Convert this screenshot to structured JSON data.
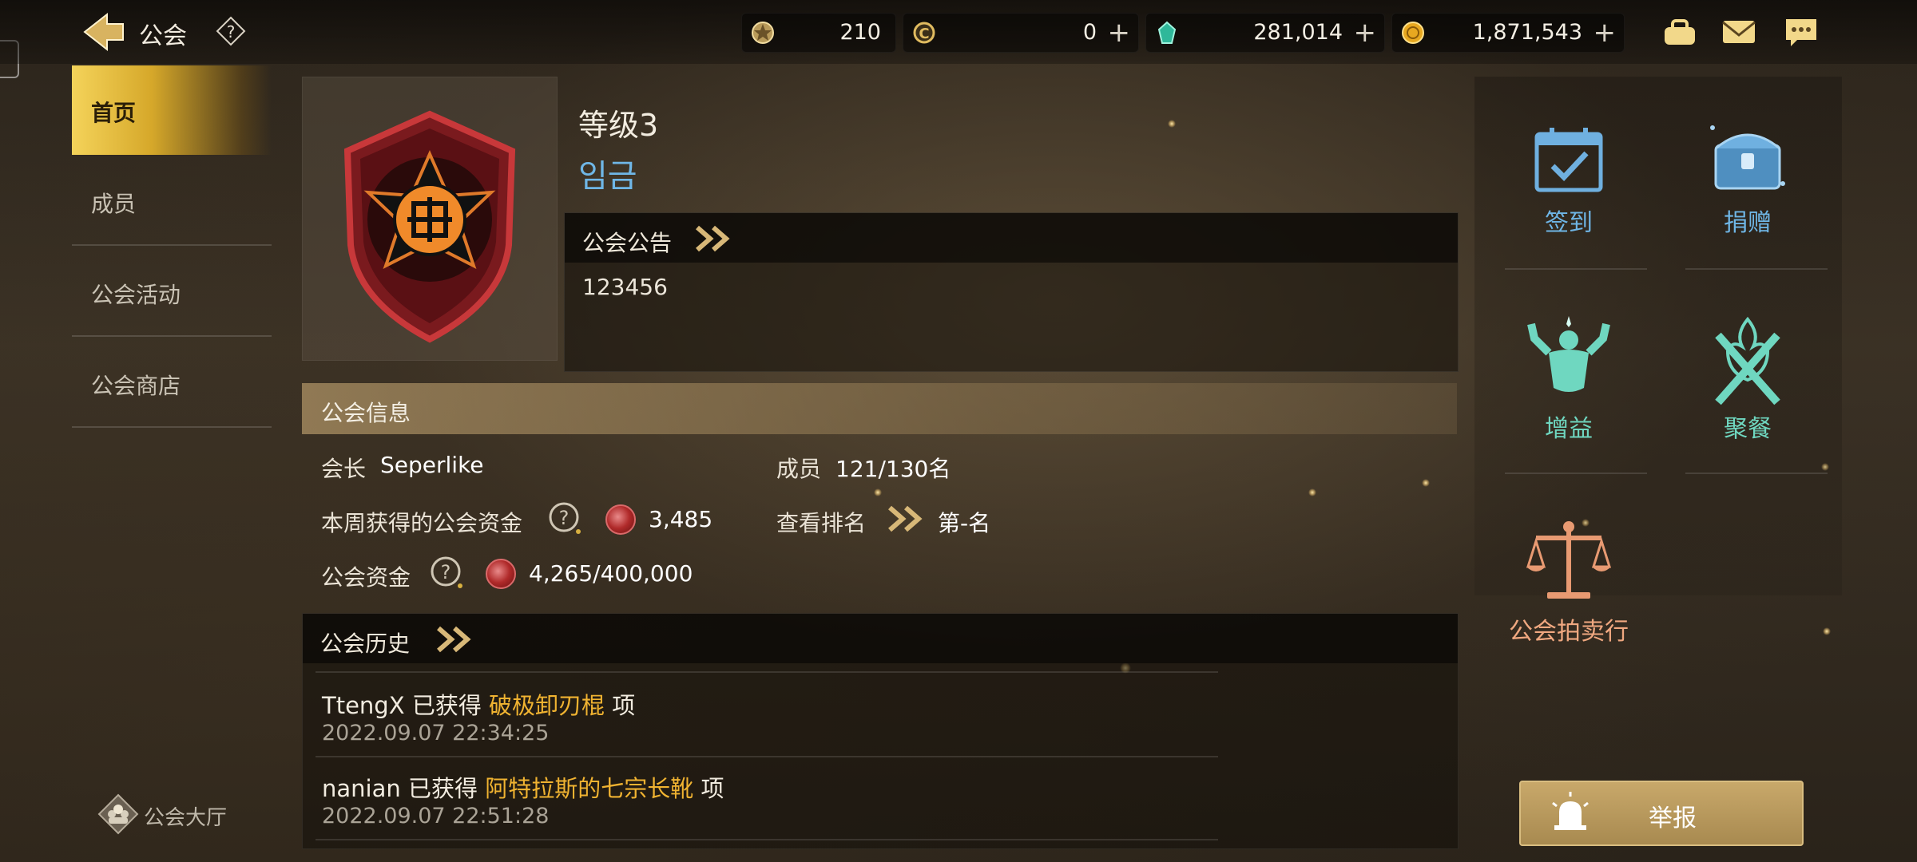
{
  "topbar": {
    "title": "公会",
    "resources": [
      {
        "icon": "medal-icon",
        "value": "210",
        "plus": false
      },
      {
        "icon": "c-coin-icon",
        "value": "0",
        "plus": true
      },
      {
        "icon": "green-gem-icon",
        "value": "281,014",
        "plus": true
      },
      {
        "icon": "gold-coin-icon",
        "value": "1,871,543",
        "plus": true
      }
    ]
  },
  "nav": {
    "items": [
      {
        "label": "首页",
        "active": true
      },
      {
        "label": "成员",
        "active": false
      },
      {
        "label": "公会活动",
        "active": false
      },
      {
        "label": "公会商店",
        "active": false
      }
    ],
    "hall_label": "公会大厅"
  },
  "guild": {
    "level": "等级3",
    "name": "임금"
  },
  "notice": {
    "title": "公会公告",
    "text": "123456"
  },
  "info": {
    "title": "公会信息",
    "leader_label": "会长",
    "leader_value": "Seperlike",
    "members_label": "成员",
    "members_value": "121/130名",
    "weekly_funds_label": "本周获得的公会资金",
    "weekly_funds_value": "3,485",
    "ranking_label": "查看排名",
    "ranking_value": "第-名",
    "funds_label": "公会资金",
    "funds_value": "4,265/400,000"
  },
  "history": {
    "title": "公会历史",
    "entries": [
      {
        "user": "TtengX",
        "action": "已获得",
        "item": "破极卸刃棍",
        "suffix": "项",
        "time": "2022.09.07 22:34:25"
      },
      {
        "user": "nanian",
        "action": "已获得",
        "item": "阿特拉斯的七宗长靴",
        "suffix": "项",
        "time": "2022.09.07 22:51:28"
      }
    ]
  },
  "actions": {
    "checkin": "签到",
    "donate": "捐赠",
    "buff": "增益",
    "feast": "聚餐",
    "auction": "公会拍卖行",
    "report": "举报"
  },
  "colors": {
    "accent_gold": "#f0b331",
    "name_blue": "#6fb6e6",
    "teal": "#6fd7c0",
    "auction_orange": "#f0a880"
  }
}
